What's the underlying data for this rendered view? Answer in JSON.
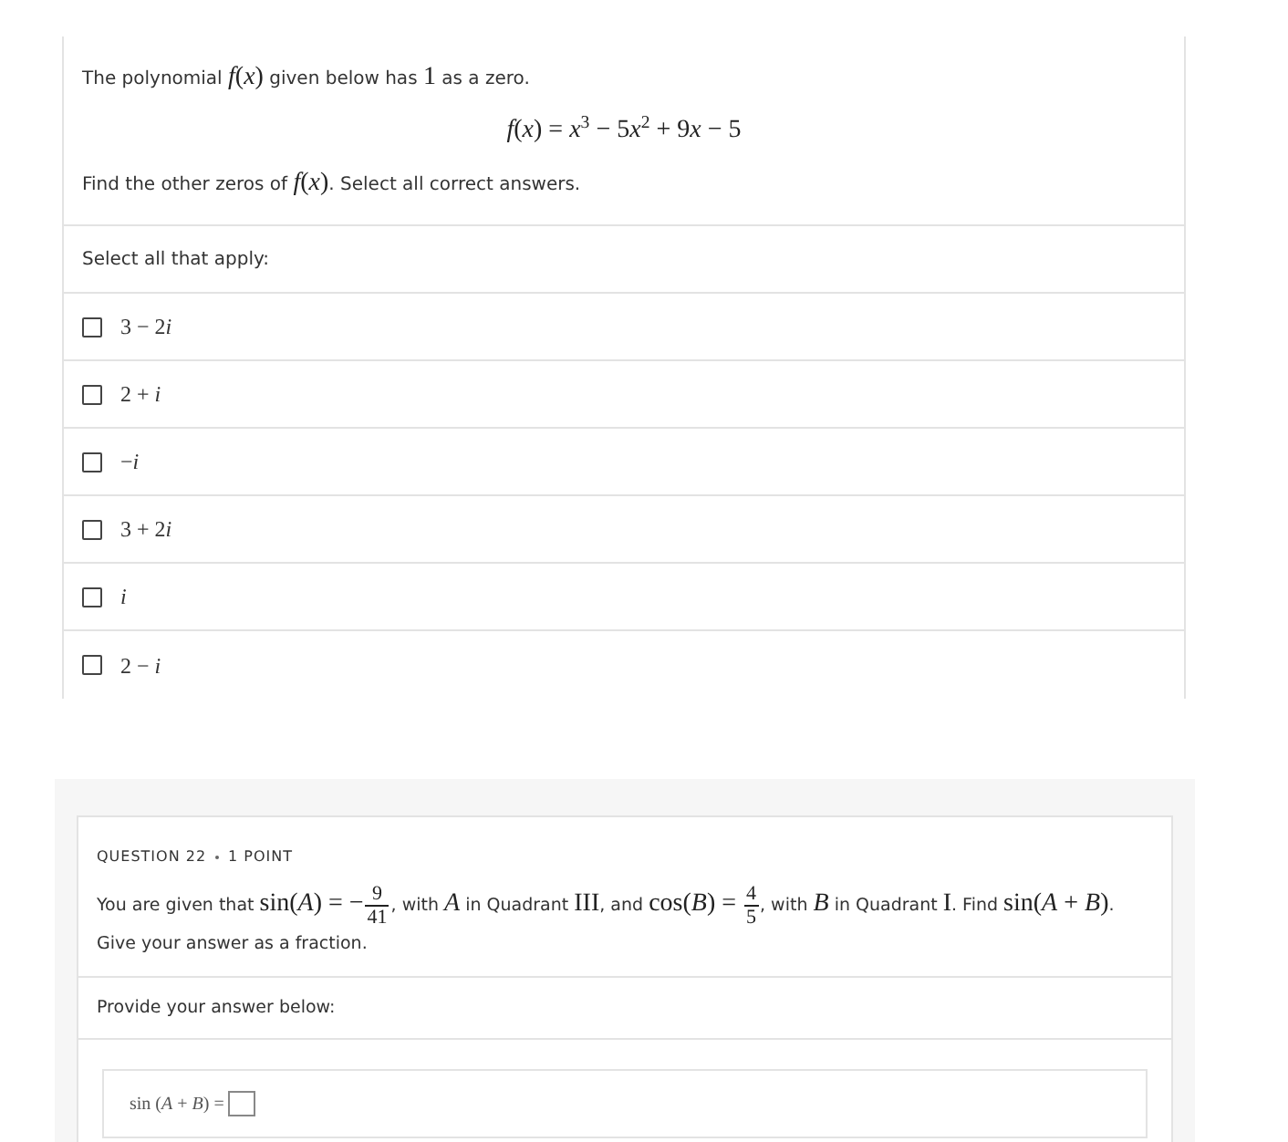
{
  "question_1": {
    "intro": [
      {
        "kind": "text",
        "text": "The polynomial "
      },
      {
        "kind": "math",
        "text": "*f*(*x*)"
      },
      {
        "kind": "text",
        "text": " given below has "
      },
      {
        "kind": "math",
        "text": "1"
      },
      {
        "kind": "text",
        "text": " as a zero."
      }
    ],
    "equation": [
      {
        "kind": "var",
        "text": "f"
      },
      {
        "kind": "num",
        "text": "("
      },
      {
        "kind": "var",
        "text": "x"
      },
      {
        "kind": "num",
        "text": ") = "
      },
      {
        "kind": "var",
        "text": "x"
      },
      {
        "kind": "sup",
        "text": "3"
      },
      {
        "kind": "num",
        "text": " − 5"
      },
      {
        "kind": "var",
        "text": "x"
      },
      {
        "kind": "sup",
        "text": "2"
      },
      {
        "kind": "num",
        "text": " + 9"
      },
      {
        "kind": "var",
        "text": "x"
      },
      {
        "kind": "num",
        "text": " − 5"
      }
    ],
    "prompt": [
      {
        "kind": "text",
        "text": "Find the other zeros of "
      },
      {
        "kind": "math",
        "text": "*f*(*x*)"
      },
      {
        "kind": "text",
        "text": ". Select all correct answers."
      }
    ],
    "instruction": "Select all that apply:",
    "options": [
      {
        "label": [
          {
            "kind": "num",
            "text": "3 − 2"
          },
          {
            "kind": "var",
            "text": "i"
          }
        ],
        "checked": false
      },
      {
        "label": [
          {
            "kind": "num",
            "text": "2 + "
          },
          {
            "kind": "var",
            "text": "i"
          }
        ],
        "checked": false
      },
      {
        "label": [
          {
            "kind": "num",
            "text": "−"
          },
          {
            "kind": "var",
            "text": "i"
          }
        ],
        "checked": false
      },
      {
        "label": [
          {
            "kind": "num",
            "text": "3 + 2"
          },
          {
            "kind": "var",
            "text": "i"
          }
        ],
        "checked": false
      },
      {
        "label": [
          {
            "kind": "var",
            "text": "i"
          }
        ],
        "checked": false
      },
      {
        "label": [
          {
            "kind": "num",
            "text": "2 − "
          },
          {
            "kind": "var",
            "text": "i"
          }
        ],
        "checked": false
      }
    ]
  },
  "question_2": {
    "header": "QUESTION 22",
    "points": "1 POINT",
    "statement": [
      {
        "kind": "text",
        "text": "You are given that "
      },
      {
        "kind": "math",
        "text": "sin(*A*) = −"
      },
      {
        "kind": "frac",
        "num": "9",
        "den": "41"
      },
      {
        "kind": "text",
        "text": ", with "
      },
      {
        "kind": "math",
        "text": "*A*"
      },
      {
        "kind": "text",
        "text": " in Quadrant "
      },
      {
        "kind": "math",
        "text": "III"
      },
      {
        "kind": "text",
        "text": ", and "
      },
      {
        "kind": "math",
        "text": "cos(*B*) = "
      },
      {
        "kind": "frac",
        "num": "4",
        "den": "5"
      },
      {
        "kind": "text",
        "text": ", with "
      },
      {
        "kind": "math",
        "text": "*B*"
      },
      {
        "kind": "text",
        "text": " in Quadrant "
      },
      {
        "kind": "math",
        "text": "I"
      },
      {
        "kind": "text",
        "text": ". Find "
      },
      {
        "kind": "math",
        "text": "sin(*A* + *B*)"
      },
      {
        "kind": "text",
        "text": "."
      }
    ],
    "note": "Give your answer as a fraction.",
    "answer_prompt": "Provide your answer below:",
    "answer_label": "sin (*A* + *B*) ="
  }
}
